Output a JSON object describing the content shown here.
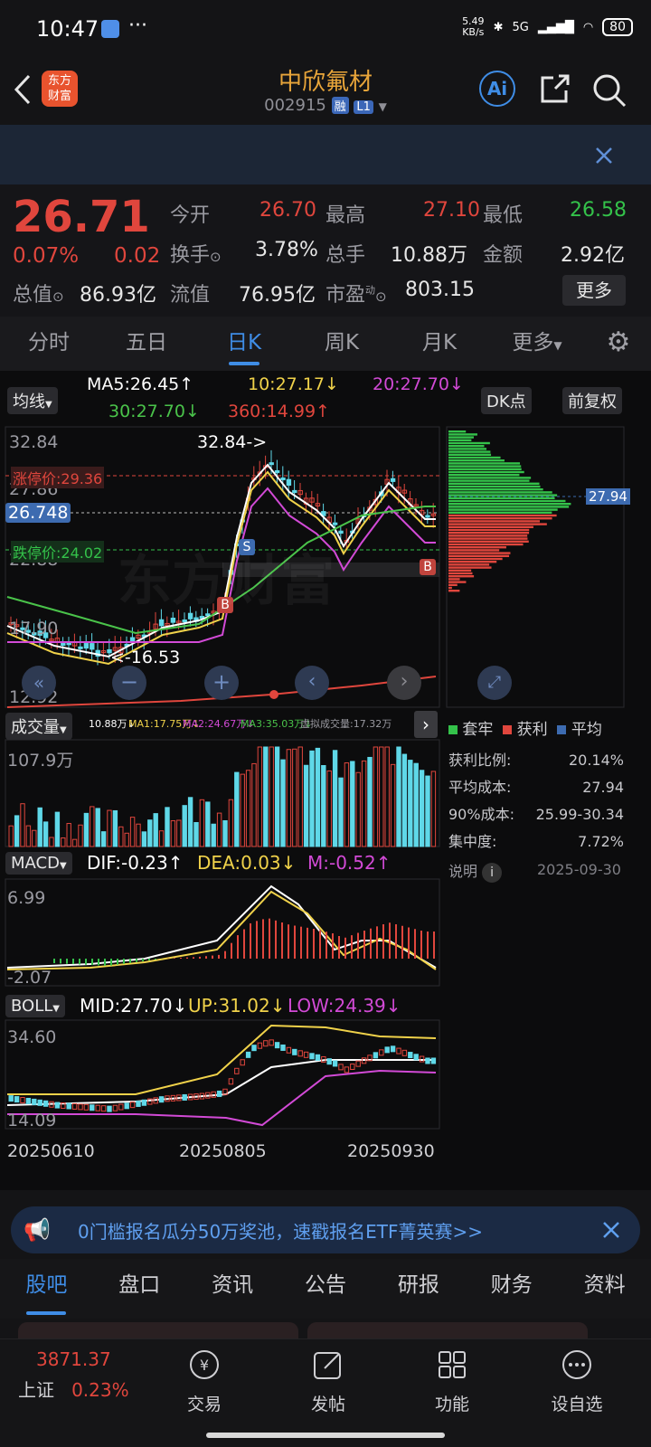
{
  "status_bar": {
    "time": "10:47",
    "net_speed_value": "5.49",
    "net_speed_unit": "KB/s",
    "network": "5G",
    "battery": "80"
  },
  "header": {
    "logo_line1": "东方",
    "logo_line2": "财富",
    "stock_name": "中欣氟材",
    "stock_code": "002915",
    "tag_margin": "融",
    "tag_level": "L1"
  },
  "quote": {
    "price": "26.71",
    "change_pct": "0.07%",
    "change_amt": "0.02",
    "open_label": "今开",
    "open": "26.70",
    "high_label": "最高",
    "high": "27.10",
    "low_label": "最低",
    "low": "26.58",
    "turnover_label": "换手",
    "turnover": "3.78%",
    "volume_label": "总手",
    "volume": "10.88万",
    "amount_label": "金额",
    "amount": "2.92亿",
    "total_mv_label": "总值",
    "total_mv": "86.93亿",
    "float_mv_label": "流值",
    "float_mv": "76.95亿",
    "pe_label": "市盈",
    "pe_sup": "动",
    "pe": "803.15",
    "more_button": "更多"
  },
  "period_tabs": [
    "分时",
    "五日",
    "日K",
    "周K",
    "月K",
    "更多"
  ],
  "kline": {
    "ma_selector": "均线",
    "ma5": "MA5:26.45↑",
    "ma10": "10:27.17↓",
    "ma20": "20:27.70↓",
    "ma30": "30:27.70↓",
    "ma360": "360:14.99↑",
    "dk_button": "DK点",
    "adjust_button": "前复权",
    "y_top": "32.84",
    "y_2": "27.86",
    "y_3": "22.88",
    "y_4": "17.90",
    "y_bottom": "12.92",
    "current_price_tag": "26.748",
    "limit_up": "涨停价:29.36",
    "limit_down": "跌停价:24.02",
    "high_marker": "32.84->",
    "low_marker": "<-16.53",
    "chip_price_tag": "27.94",
    "marker_s": "S",
    "marker_b": "B",
    "watermark": "东方财富"
  },
  "volume_panel": {
    "selector": "成交量",
    "vol": "10.88万↓",
    "ma1": "MA1:17.75万↓",
    "ma2": "MA2:24.67万↓",
    "ma3": "MA3:35.03万↓",
    "virtual": "虚拟成交量:17.32万",
    "y_top": "107.9万"
  },
  "macd_panel": {
    "selector": "MACD",
    "dif": "DIF:-0.23↑",
    "dea": "DEA:0.03↓",
    "m": "M:-0.52↑",
    "y_top": "6.99",
    "y_bottom": "-2.07"
  },
  "boll_panel": {
    "selector": "BOLL",
    "mid": "MID:27.70↓",
    "up": "UP:31.02↓",
    "low": "LOW:24.39↓",
    "y_top": "34.60",
    "y_bottom": "14.09"
  },
  "dates": [
    "20250610",
    "20250805",
    "20250930"
  ],
  "chips": {
    "legend_trapped": "套牢",
    "legend_profit": "获利",
    "legend_avg": "平均",
    "rows": [
      {
        "label": "获利比例:",
        "value": "20.14%"
      },
      {
        "label": "平均成本:",
        "value": "27.94"
      },
      {
        "label": "90%成本:",
        "value": "25.99-30.34"
      },
      {
        "label": "集中度:",
        "value": "7.72%"
      }
    ],
    "note_label": "说明",
    "date": "2025-09-30"
  },
  "promo": {
    "text": "0门槛报名瓜分50万奖池，速戳报名ETF菁英赛>>"
  },
  "bottom_tabs": [
    "股吧",
    "盘口",
    "资讯",
    "公告",
    "研报",
    "财务",
    "资料"
  ],
  "nav": {
    "index_value": "3871.37",
    "index_name": "上证",
    "index_change": "0.23%",
    "trade": "交易",
    "post": "发帖",
    "function": "功能",
    "watchlist": "设自选"
  },
  "colors": {
    "up": "#e0463d",
    "down": "#34c24a",
    "accent": "#3f8de6",
    "title": "#e8a53a",
    "ma10": "#f0d24a",
    "ma20": "#d24ad6",
    "ma30": "#4ac34a"
  }
}
